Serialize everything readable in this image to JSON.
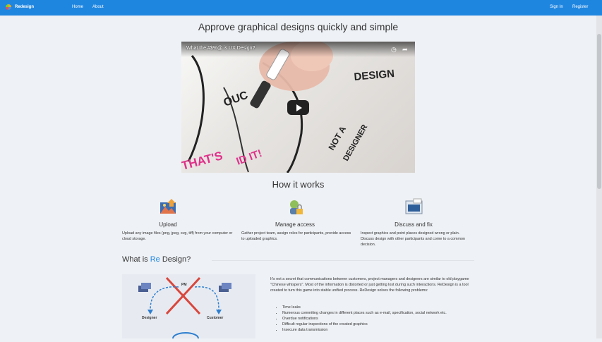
{
  "nav": {
    "brand": "Redesign",
    "home": "Home",
    "about": "About",
    "sign_in": "Sign In",
    "register": "Register"
  },
  "hero": {
    "title": "Approve graphical designs quickly and simple",
    "video_title": "What the #$%@ is UX Design?"
  },
  "how": {
    "title": "How it works",
    "features": [
      {
        "name": "Upload",
        "desc": "Upload any image files (png, jpeg, svg, tiff) from your computer or cloud storage.",
        "icon": "upload-image-icon"
      },
      {
        "name": "Manage access",
        "desc": "Gather project team, assign roles for participants, provide access to uploaded graphics.",
        "icon": "lock-user-icon"
      },
      {
        "name": "Discuss and fix",
        "desc": "Inspect graphics and point places designed wrong or plain. Discuss design with other participants and come to a common decision.",
        "icon": "chat-window-icon"
      }
    ]
  },
  "what": {
    "title_prefix": "What is ",
    "title_accent": "Re",
    "title_suffix": " Design?",
    "para": "It's not a secret that communications between customers, project managers and designers are similar to old playgame \"Chinese whispers\". Most of the information is distorted or just getting lost during such interactions. ReDesign is a tool created to turn this game into stable unified process. ReDesign solves the following problems:",
    "items": [
      "Time leaks",
      "Numerous commiting changes in different places such as e-mail, specification, social network etc.",
      "Overdue notifications",
      "Difficult regular inspections of the created graphics",
      "Insecure data transmission"
    ],
    "diagram": {
      "pm": "PM",
      "designer": "Designer",
      "customer": "Customer"
    }
  },
  "colors": {
    "accent": "#1f86e0",
    "background": "#eef1f5"
  }
}
